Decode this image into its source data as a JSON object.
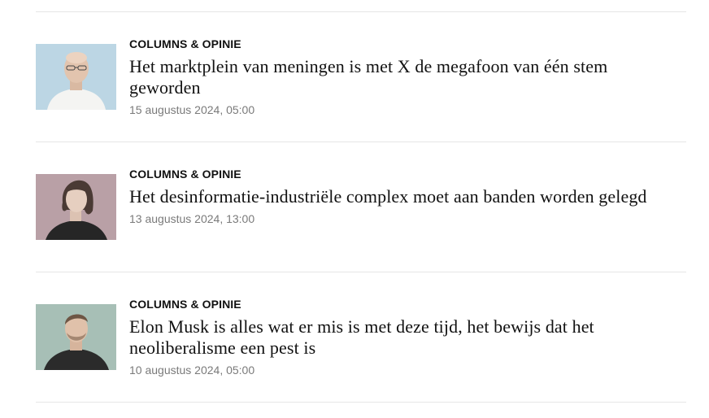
{
  "articles": [
    {
      "category": "COLUMNS & OPINIE",
      "title": "Het marktplein van meningen is met X de megafoon van één stem geworden",
      "date": "15 augustus 2024, 05:00",
      "thumb_bg": "#bcd6e4"
    },
    {
      "category": "COLUMNS & OPINIE",
      "title": "Het desinformatie-industriële complex moet aan banden worden gelegd",
      "date": "13 augustus 2024, 13:00",
      "thumb_bg": "#b9a0a6"
    },
    {
      "category": "COLUMNS & OPINIE",
      "title": "Elon Musk is alles wat er mis is met deze tijd, het bewijs dat het neoliberalisme een pest is",
      "date": "10 augustus 2024, 05:00",
      "thumb_bg": "#a7bfb6"
    }
  ]
}
